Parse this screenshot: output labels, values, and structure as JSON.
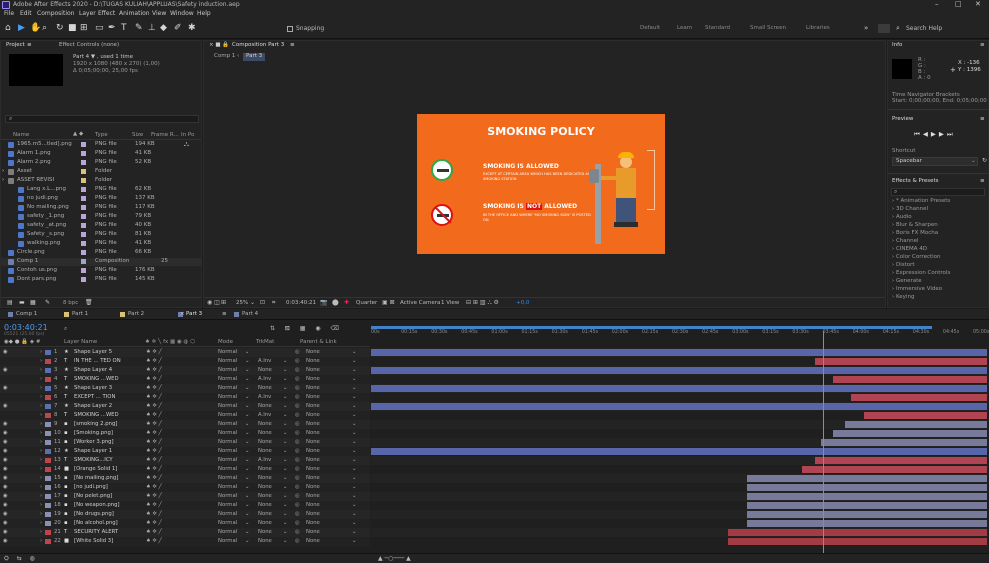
{
  "window": {
    "title": "Adobe After Effects 2020 - D:\\TUGAS KULIAH\\APPLUAS\\Safety induction.aep",
    "minimize": "–",
    "maximize": "□",
    "close": "✕"
  },
  "menu": [
    "File",
    "Edit",
    "Composition",
    "Layer",
    "Effect",
    "Animation",
    "View",
    "Window",
    "Help"
  ],
  "toolbar": {
    "snapping": "Snapping",
    "workspaces": [
      "Default",
      "Learn",
      "Standard",
      "Small Screen",
      "Libraries"
    ],
    "search_placeholder": "Search Help"
  },
  "project": {
    "tab": "Project",
    "tab2": "Effect Controls (none)",
    "item_title": "Part 4 ▼ , used 1 time",
    "item_dims": "1920 x 1080 (480 x 270) (1,00)",
    "item_dur": "Δ 0;05;00;00, 25,00 fps",
    "search_icon": "⌕",
    "col_name": "Name",
    "col_type": "Type",
    "col_size": "Size",
    "col_frame": "Frame R...",
    "col_in": "In Po",
    "items": [
      {
        "name": "1965.m5...tled].png",
        "type": "PNG file",
        "size": "194 KB",
        "color": "#b9a6d9",
        "indent": 0
      },
      {
        "name": "Alarm 1.png",
        "type": "PNG file",
        "size": "41 KB",
        "color": "#b9a6d9",
        "indent": 0
      },
      {
        "name": "Alarm 2.png",
        "type": "PNG file",
        "size": "52 KB",
        "color": "#b9a6d9",
        "indent": 0
      },
      {
        "name": "Asset",
        "type": "Folder",
        "size": "",
        "color": "#d8c274",
        "indent": 0
      },
      {
        "name": "ASSET REVISI",
        "type": "Folder",
        "size": "",
        "color": "#d8c274",
        "indent": 0
      },
      {
        "name": "Lang x.L...png",
        "type": "PNG file",
        "size": "62 KB",
        "color": "#b9a6d9",
        "indent": 1
      },
      {
        "name": "no judi.png",
        "type": "PNG file",
        "size": "137 KB",
        "color": "#b9a6d9",
        "indent": 1
      },
      {
        "name": "No mailing.png",
        "type": "PNG file",
        "size": "117 KB",
        "color": "#b9a6d9",
        "indent": 1
      },
      {
        "name": "safety _1.png",
        "type": "PNG file",
        "size": "79 KB",
        "color": "#b9a6d9",
        "indent": 1
      },
      {
        "name": "safety _at.png",
        "type": "PNG file",
        "size": "40 KB",
        "color": "#b9a6d9",
        "indent": 1
      },
      {
        "name": "Safety _s.png",
        "type": "PNG file",
        "size": "81 KB",
        "color": "#b9a6d9",
        "indent": 1
      },
      {
        "name": "walking.png",
        "type": "PNG file",
        "size": "41 KB",
        "color": "#b9a6d9",
        "indent": 1
      },
      {
        "name": "Circle.png",
        "type": "PNG file",
        "size": "66 KB",
        "color": "#b9a6d9",
        "indent": 0
      },
      {
        "name": "Comp 1",
        "type": "Composition",
        "size": "",
        "frame": "25",
        "color": "#9aa7c7",
        "indent": 0
      },
      {
        "name": "Contoh us.png",
        "type": "PNG file",
        "size": "176 KB",
        "color": "#b9a6d9",
        "indent": 0
      },
      {
        "name": "Dont pars.png",
        "type": "PNG file",
        "size": "145 KB",
        "color": "#b9a6d9",
        "indent": 0
      }
    ],
    "footer_bpc": "8 bpc"
  },
  "comp": {
    "tab": "Composition Part 3",
    "crumbs": [
      "Comp 1",
      "Part 3"
    ],
    "slide": {
      "title": "SMOKING POLICY",
      "allowed_title": "SMOKING IS ALLOWED",
      "allowed_sub": "EXCEPT AT CERTAIN AREA WHICH HAS BEEN DEDICATED AS SMOKING STATION",
      "not_pre": "SMOKING IS ",
      "not_word": "NOT",
      "not_post": " ALLOWED",
      "not_sub": "IN THE OFFICE AND WHERE \"NO SMOKING SIGN\" IS POSTED ON"
    },
    "footer": {
      "zoom": "25%",
      "timecode": "0:03:40:21",
      "quality": "Quarter",
      "camera": "Active Camera",
      "view": "1 View",
      "offset": "+0,0"
    }
  },
  "right": {
    "info": "Info",
    "r": "R :",
    "g": "G :",
    "b": "B :",
    "a": "A : 0",
    "x": "X : -136",
    "y": "Y : 1396",
    "tn": "Time Navigator Brackets",
    "tn2": "Start: 0;00;00;00, End: 0;05;00;00",
    "preview": "Preview",
    "shortcut": "Shortcut",
    "shortcut_val": "Spacebar",
    "fx": "Effects & Presets",
    "fx_items": [
      "* Animation Presets",
      "3D Channel",
      "Audio",
      "Blur & Sharpen",
      "Boris FX Mocha",
      "Channel",
      "CINEMA 4D",
      "Color Correction",
      "Distort",
      "Expression Controls",
      "Generate",
      "Immersive Video",
      "Keying"
    ]
  },
  "timeline": {
    "tabs": [
      "Comp 1",
      "Part 1",
      "Part 2",
      "Part 3",
      "Part 4"
    ],
    "timecode": "0:03:40:21",
    "timecode_sub": "05521 (25.00 fps)",
    "col_source": "Layer Name",
    "col_mode": "Mode",
    "col_trkmat": "TrkMat",
    "col_parent": "Parent & Link",
    "ruler": [
      "00s",
      "00:15s",
      "00:30s",
      "00:45s",
      "01:00s",
      "01:15s",
      "01:30s",
      "01:45s",
      "02:00s",
      "02:15s",
      "02:30s",
      "02:45s",
      "03:00s",
      "03:15s",
      "03:30s",
      "03:45s",
      "04:00s",
      "04:15s",
      "04:30s",
      "04:45s",
      "05:00s"
    ],
    "layers": [
      {
        "n": "1",
        "kind": "star",
        "name": "Shape Layer 5",
        "mode": "Normal",
        "trk": "",
        "parent": "None",
        "label": "#5b6fb3",
        "start": 0.0,
        "end": 1.0,
        "barc": "#5865a8"
      },
      {
        "n": "2",
        "kind": "T",
        "name": "IN THE ... TED ON",
        "mode": "Normal",
        "trk": "A.Inv",
        "parent": "None",
        "label": "#c0444e",
        "start": 0.72,
        "end": 1.0,
        "barc": "#b04452"
      },
      {
        "n": "3",
        "kind": "star",
        "name": "Shape Layer 4",
        "mode": "Normal",
        "trk": "None",
        "parent": "None",
        "label": "#5b6fb3",
        "start": 0.0,
        "end": 1.0,
        "barc": "#5865a8"
      },
      {
        "n": "4",
        "kind": "T",
        "name": "SMOKING ...WED",
        "mode": "Normal",
        "trk": "A.Inv",
        "parent": "None",
        "label": "#c0444e",
        "start": 0.75,
        "end": 1.0,
        "barc": "#b04452"
      },
      {
        "n": "5",
        "kind": "star",
        "name": "Shape Layer 3",
        "mode": "Normal",
        "trk": "None",
        "parent": "None",
        "label": "#5b6fb3",
        "start": 0.0,
        "end": 1.0,
        "barc": "#5865a8"
      },
      {
        "n": "6",
        "kind": "T",
        "name": "EXCEPT ... TION",
        "mode": "Normal",
        "trk": "A.Inv",
        "parent": "None",
        "label": "#c0444e",
        "start": 0.78,
        "end": 1.0,
        "barc": "#b04452"
      },
      {
        "n": "7",
        "kind": "star",
        "name": "Shape Layer 2",
        "mode": "Normal",
        "trk": "None",
        "parent": "None",
        "label": "#5b6fb3",
        "start": 0.0,
        "end": 1.0,
        "barc": "#5865a8"
      },
      {
        "n": "8",
        "kind": "T",
        "name": "SMOKING ...WED",
        "mode": "Normal",
        "trk": "A.Inv",
        "parent": "None",
        "label": "#c0444e",
        "start": 0.8,
        "end": 1.0,
        "barc": "#b04452"
      },
      {
        "n": "9",
        "kind": "img",
        "name": "[smoking 2.png]",
        "mode": "Normal",
        "trk": "None",
        "parent": "None",
        "label": "#8a8fb4",
        "start": 0.77,
        "end": 1.0,
        "barc": "#777a99"
      },
      {
        "n": "10",
        "kind": "img",
        "name": "[Smoking.png]",
        "mode": "Normal",
        "trk": "None",
        "parent": "None",
        "label": "#8a8fb4",
        "start": 0.75,
        "end": 1.0,
        "barc": "#777a99"
      },
      {
        "n": "11",
        "kind": "img",
        "name": "[Worker 3.png]",
        "mode": "Normal",
        "trk": "None",
        "parent": "None",
        "label": "#8a8fb4",
        "start": 0.73,
        "end": 1.0,
        "barc": "#777a99"
      },
      {
        "n": "12",
        "kind": "star",
        "name": "Shape Layer 1",
        "mode": "Normal",
        "trk": "None",
        "parent": "None",
        "label": "#5b6fb3",
        "start": 0.0,
        "end": 1.0,
        "barc": "#5865a8"
      },
      {
        "n": "13",
        "kind": "T",
        "name": "SMOKING...ICY",
        "mode": "Normal",
        "trk": "A.Inv",
        "parent": "None",
        "label": "#c0444e",
        "start": 0.72,
        "end": 1.0,
        "barc": "#b04452"
      },
      {
        "n": "14",
        "kind": "solid",
        "name": "[Orange Solid 1]",
        "mode": "Normal",
        "trk": "None",
        "parent": "None",
        "label": "#c0444e",
        "start": 0.7,
        "end": 1.0,
        "barc": "#b04452"
      },
      {
        "n": "15",
        "kind": "img",
        "name": "[No mailing.png]",
        "mode": "Normal",
        "trk": "None",
        "parent": "None",
        "label": "#8a8fb4",
        "start": 0.61,
        "end": 1.0,
        "barc": "#777a99"
      },
      {
        "n": "16",
        "kind": "img",
        "name": "[no judi.png]",
        "mode": "Normal",
        "trk": "None",
        "parent": "None",
        "label": "#8a8fb4",
        "start": 0.61,
        "end": 1.0,
        "barc": "#777a99"
      },
      {
        "n": "17",
        "kind": "img",
        "name": "[No pelet.png]",
        "mode": "Normal",
        "trk": "None",
        "parent": "None",
        "label": "#8a8fb4",
        "start": 0.61,
        "end": 1.0,
        "barc": "#777a99"
      },
      {
        "n": "18",
        "kind": "img",
        "name": "[No weapon.png]",
        "mode": "Normal",
        "trk": "None",
        "parent": "None",
        "label": "#8a8fb4",
        "start": 0.61,
        "end": 1.0,
        "barc": "#777a99"
      },
      {
        "n": "19",
        "kind": "img",
        "name": "[No drugs.png]",
        "mode": "Normal",
        "trk": "None",
        "parent": "None",
        "label": "#8a8fb4",
        "start": 0.61,
        "end": 1.0,
        "barc": "#777a99"
      },
      {
        "n": "20",
        "kind": "img",
        "name": "[No alcohol.png]",
        "mode": "Normal",
        "trk": "None",
        "parent": "None",
        "label": "#8a8fb4",
        "start": 0.61,
        "end": 1.0,
        "barc": "#777a99"
      },
      {
        "n": "21",
        "kind": "T",
        "name": "SECURITY ALERT",
        "mode": "Normal",
        "trk": "None",
        "parent": "None",
        "label": "#c0444e",
        "start": 0.58,
        "end": 1.0,
        "barc": "#a23b44"
      },
      {
        "n": "22",
        "kind": "solid",
        "name": "[White Solid 3]",
        "mode": "Normal",
        "trk": "None",
        "parent": "None",
        "label": "#c0444e",
        "start": 0.58,
        "end": 1.0,
        "barc": "#a23b44"
      }
    ],
    "playhead": 0.733,
    "work_end": 0.91
  },
  "colors": {
    "accent": "#2d8ceb",
    "slide_orange": "#f26a1b",
    "timeline_blue": "#5865a8"
  }
}
